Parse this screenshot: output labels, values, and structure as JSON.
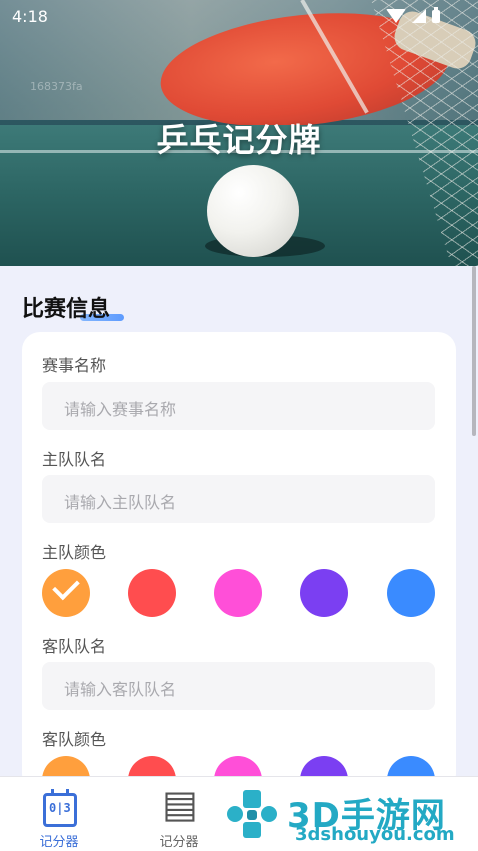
{
  "status_bar": {
    "time": "4:18"
  },
  "hero": {
    "watermark": "168373fa",
    "title": "乒乓记分牌"
  },
  "section": {
    "title": "比赛信息"
  },
  "form": {
    "event_name_label": "赛事名称",
    "event_name_placeholder": "请输入赛事名称",
    "home_team_label": "主队队名",
    "home_team_placeholder": "请输入主队队名",
    "home_color_label": "主队颜色",
    "away_team_label": "客队队名",
    "away_team_placeholder": "请输入客队队名",
    "away_color_label": "客队颜色"
  },
  "colors": {
    "swatches": [
      "#ff9f3d",
      "#ff4d4f",
      "#ff4fd8",
      "#7b3ff2",
      "#3a8bff"
    ],
    "home_selected_index": 0,
    "accent": "#3b6fd8"
  },
  "tabbar": {
    "tabs": [
      {
        "label": "记分器",
        "icon": "calendar-score-icon",
        "active": true
      },
      {
        "label": "记分器",
        "icon": "score-board-icon",
        "active": false
      }
    ]
  },
  "watermark_logo": {
    "brand": "3D手游网",
    "url": "3dshouyou.com"
  }
}
